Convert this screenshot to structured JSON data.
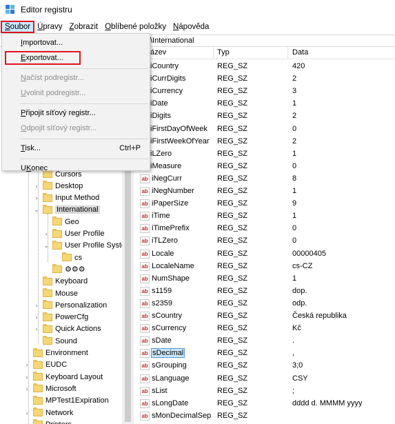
{
  "window": {
    "title": "Editor registru"
  },
  "menubar": [
    {
      "id": "soubor",
      "pre": "",
      "u": "S",
      "post": "oubor",
      "active": true
    },
    {
      "id": "upravy",
      "pre": "",
      "u": "Ú",
      "post": "pravy"
    },
    {
      "id": "zobrazit",
      "pre": "",
      "u": "Z",
      "post": "obrazit"
    },
    {
      "id": "oblibene",
      "pre": "",
      "u": "O",
      "post": "blíbené položky"
    },
    {
      "id": "napoveda",
      "pre": "",
      "u": "N",
      "post": "ápověda"
    }
  ],
  "address": "\\International",
  "dropdown": {
    "items": [
      {
        "label_u": "I",
        "label": "mportovat...",
        "disabled": false
      },
      {
        "label_u": "E",
        "label": "xportovat...",
        "disabled": false,
        "highlight": true
      },
      {
        "sep": true
      },
      {
        "label_u": "N",
        "label": "ačíst podregistr...",
        "disabled": true
      },
      {
        "label_u": "U",
        "label": "volnit podregistr...",
        "disabled": true
      },
      {
        "sep": true
      },
      {
        "label_u": "P",
        "label": "řipojit síťový registr...",
        "disabled": false
      },
      {
        "label_u": "O",
        "label": "dpojit síťový registr...",
        "disabled": true
      },
      {
        "sep": true
      },
      {
        "label_u": "T",
        "label": "isk...",
        "disabled": false,
        "shortcut": "Ctrl+P"
      },
      {
        "sep": true
      },
      {
        "label_u": "K",
        "label": "onec",
        "disabled": false,
        "pre": "U"
      }
    ]
  },
  "tree": [
    {
      "label": "Cursors",
      "depth": 2,
      "chev": ""
    },
    {
      "label": "Desktop",
      "depth": 2,
      "chev": ">"
    },
    {
      "label": "Input Method",
      "depth": 2,
      "chev": ">"
    },
    {
      "label": "International",
      "depth": 2,
      "chev": "v",
      "selected": true
    },
    {
      "label": "Geo",
      "depth": 3,
      "chev": ""
    },
    {
      "label": "User Profile",
      "depth": 3,
      "chev": ">"
    },
    {
      "label": "User Profile Syste",
      "depth": 3,
      "chev": "v"
    },
    {
      "label": "cs",
      "depth": 4,
      "chev": ""
    },
    {
      "label": "⚙⚙⚙",
      "depth": 3,
      "chev": ""
    },
    {
      "label": "Keyboard",
      "depth": 2,
      "chev": ""
    },
    {
      "label": "Mouse",
      "depth": 2,
      "chev": ""
    },
    {
      "label": "Personalization",
      "depth": 2,
      "chev": ">"
    },
    {
      "label": "PowerCfg",
      "depth": 2,
      "chev": ">"
    },
    {
      "label": "Quick Actions",
      "depth": 2,
      "chev": ">"
    },
    {
      "label": "Sound",
      "depth": 2,
      "chev": ""
    },
    {
      "label": "Environment",
      "depth": 1,
      "chev": ""
    },
    {
      "label": "EUDC",
      "depth": 1,
      "chev": ">"
    },
    {
      "label": "Keyboard Layout",
      "depth": 1,
      "chev": ">"
    },
    {
      "label": "Microsoft",
      "depth": 1,
      "chev": ">"
    },
    {
      "label": "MPTest1Expiration",
      "depth": 1,
      "chev": ""
    },
    {
      "label": "Network",
      "depth": 1,
      "chev": ">"
    },
    {
      "label": "Printers",
      "depth": 1,
      "chev": ">"
    }
  ],
  "list": {
    "columns": {
      "name": "ázev",
      "type": "Typ",
      "data": "Data"
    },
    "rows": [
      {
        "name": "iCountry",
        "type": "REG_SZ",
        "data": "420"
      },
      {
        "name": "iCurrDigits",
        "type": "REG_SZ",
        "data": "2"
      },
      {
        "name": "iCurrency",
        "type": "REG_SZ",
        "data": "3"
      },
      {
        "name": "iDate",
        "type": "REG_SZ",
        "data": "1"
      },
      {
        "name": "iDigits",
        "type": "REG_SZ",
        "data": "2"
      },
      {
        "name": "iFirstDayOfWeek",
        "type": "REG_SZ",
        "data": "0"
      },
      {
        "name": "iFirstWeekOfYear",
        "type": "REG_SZ",
        "data": "2"
      },
      {
        "name": "iLZero",
        "type": "REG_SZ",
        "data": "1"
      },
      {
        "name": "iMeasure",
        "type": "REG_SZ",
        "data": "0"
      },
      {
        "name": "iNegCurr",
        "type": "REG_SZ",
        "data": "8"
      },
      {
        "name": "iNegNumber",
        "type": "REG_SZ",
        "data": "1"
      },
      {
        "name": "iPaperSize",
        "type": "REG_SZ",
        "data": "9"
      },
      {
        "name": "iTime",
        "type": "REG_SZ",
        "data": "1"
      },
      {
        "name": "iTimePrefix",
        "type": "REG_SZ",
        "data": "0"
      },
      {
        "name": "iTLZero",
        "type": "REG_SZ",
        "data": "0"
      },
      {
        "name": "Locale",
        "type": "REG_SZ",
        "data": "00000405"
      },
      {
        "name": "LocaleName",
        "type": "REG_SZ",
        "data": "cs-CZ"
      },
      {
        "name": "NumShape",
        "type": "REG_SZ",
        "data": "1"
      },
      {
        "name": "s1159",
        "type": "REG_SZ",
        "data": "dop."
      },
      {
        "name": "s2359",
        "type": "REG_SZ",
        "data": "odp."
      },
      {
        "name": "sCountry",
        "type": "REG_SZ",
        "data": "Česká republika"
      },
      {
        "name": "sCurrency",
        "type": "REG_SZ",
        "data": "Kč"
      },
      {
        "name": "sDate",
        "type": "REG_SZ",
        "data": "."
      },
      {
        "name": "sDecimal",
        "type": "REG_SZ",
        "data": ",",
        "selected": true
      },
      {
        "name": "sGrouping",
        "type": "REG_SZ",
        "data": "3;0"
      },
      {
        "name": "sLanguage",
        "type": "REG_SZ",
        "data": "CSY"
      },
      {
        "name": "sList",
        "type": "REG_SZ",
        "data": ";"
      },
      {
        "name": "sLongDate",
        "type": "REG_SZ",
        "data": "dddd d. MMMM yyyy"
      },
      {
        "name": "sMonDecimalSep",
        "type": "REG_SZ",
        "data": ""
      }
    ],
    "icon_text": "ab"
  },
  "colors": {
    "selection": "#cce8ff",
    "highlight_box": "#e0141e",
    "folder": "#f7d674"
  }
}
